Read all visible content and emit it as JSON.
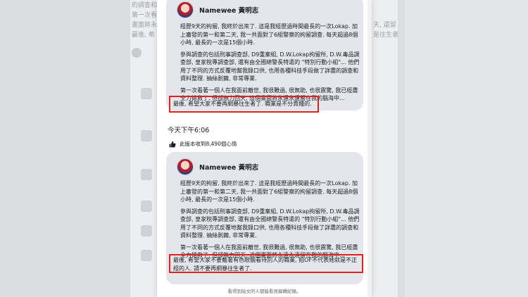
{
  "background": {
    "fragments": [
      "的調查和",
      "第一次看",
      "畫面將永",
      "最後, 希",
      "天, 還留",
      "是往生者"
    ]
  },
  "edit_history": {
    "first_version": {
      "author": "Namewee 黃明志",
      "paragraphs": [
        "經歷9天的拘留, 我終於出來了. 這是我經歷過時間最長的一次Lokap. 加上審發的第一和第二天, 我一共面對了6組警察的拘留調查. 每天超過8個小時, 最長的一次是15個小時.",
        "參與調查的包括刑事調查部, D9重案組, D.W.Lokap拘留所, D.W.毒品調查部, 皇家稅專調查部, 還有由全國總警長特遣的 \"特別行動小組\"... 他們用了不同的方式反覆地幫我錄口供, 也用各種科技手段做了詳盡的調查和資料整理. 抽絲剝繭, 非常專業.",
        "第一次看著一個人在我面前離世, 我很難過, 很無助, 也很震驚, 我已經盡全力搶救了, 但卻無力回天. 這個畫面將永遠永遠留在我的腦海中..."
      ],
      "highlighted": "最後, 希望大家不要再網暴往生者了. 職業是不分貴賤的."
    },
    "timestamp": "今天下午6:06",
    "reaction_note": "此版本收到8,490個心情",
    "second_version": {
      "author": "Namewee 黃明志",
      "paragraphs": [
        "經歷9天的拘留, 我終於出來了. 這是我經歷過時間最長的一次Lokap. 加上審發的第一和第二天, 我一共面對了6組警察的拘留調查. 每天超過8個小時, 最長的一次是15個小時.",
        "參與調查的包括刑事調查部, D9重案組, D.W.Lokap拘留所, D.W.毒品調查部, 皇家稅專調查部, 還有由全國總警長特遣的 \"特別行動小組\"... 他們用了不同的方式反覆地幫我錄口供, 也用各種科技手段做了詳盡的調查和資料整理. 抽絲剝繭, 非常專業.",
        "第一次看著一個人在我面前離世, 我很難過, 很無助, 也很震驚, 我已經盡全力搶救了, 但卻無力回天. 這個畫面將永遠永遠留在我的腦海中..."
      ],
      "highlighted": "最後, 希望大家不要戴著有色眼鏡看待別人的職業, 拍OF不代表她就是不正經的人. 請不要再網暴往生者了."
    },
    "footer": "看得到貼文的人都能看見編輯紀錄。"
  },
  "colors": {
    "highlight_border": "#e0211f",
    "bubble": "#e4e6eb"
  }
}
